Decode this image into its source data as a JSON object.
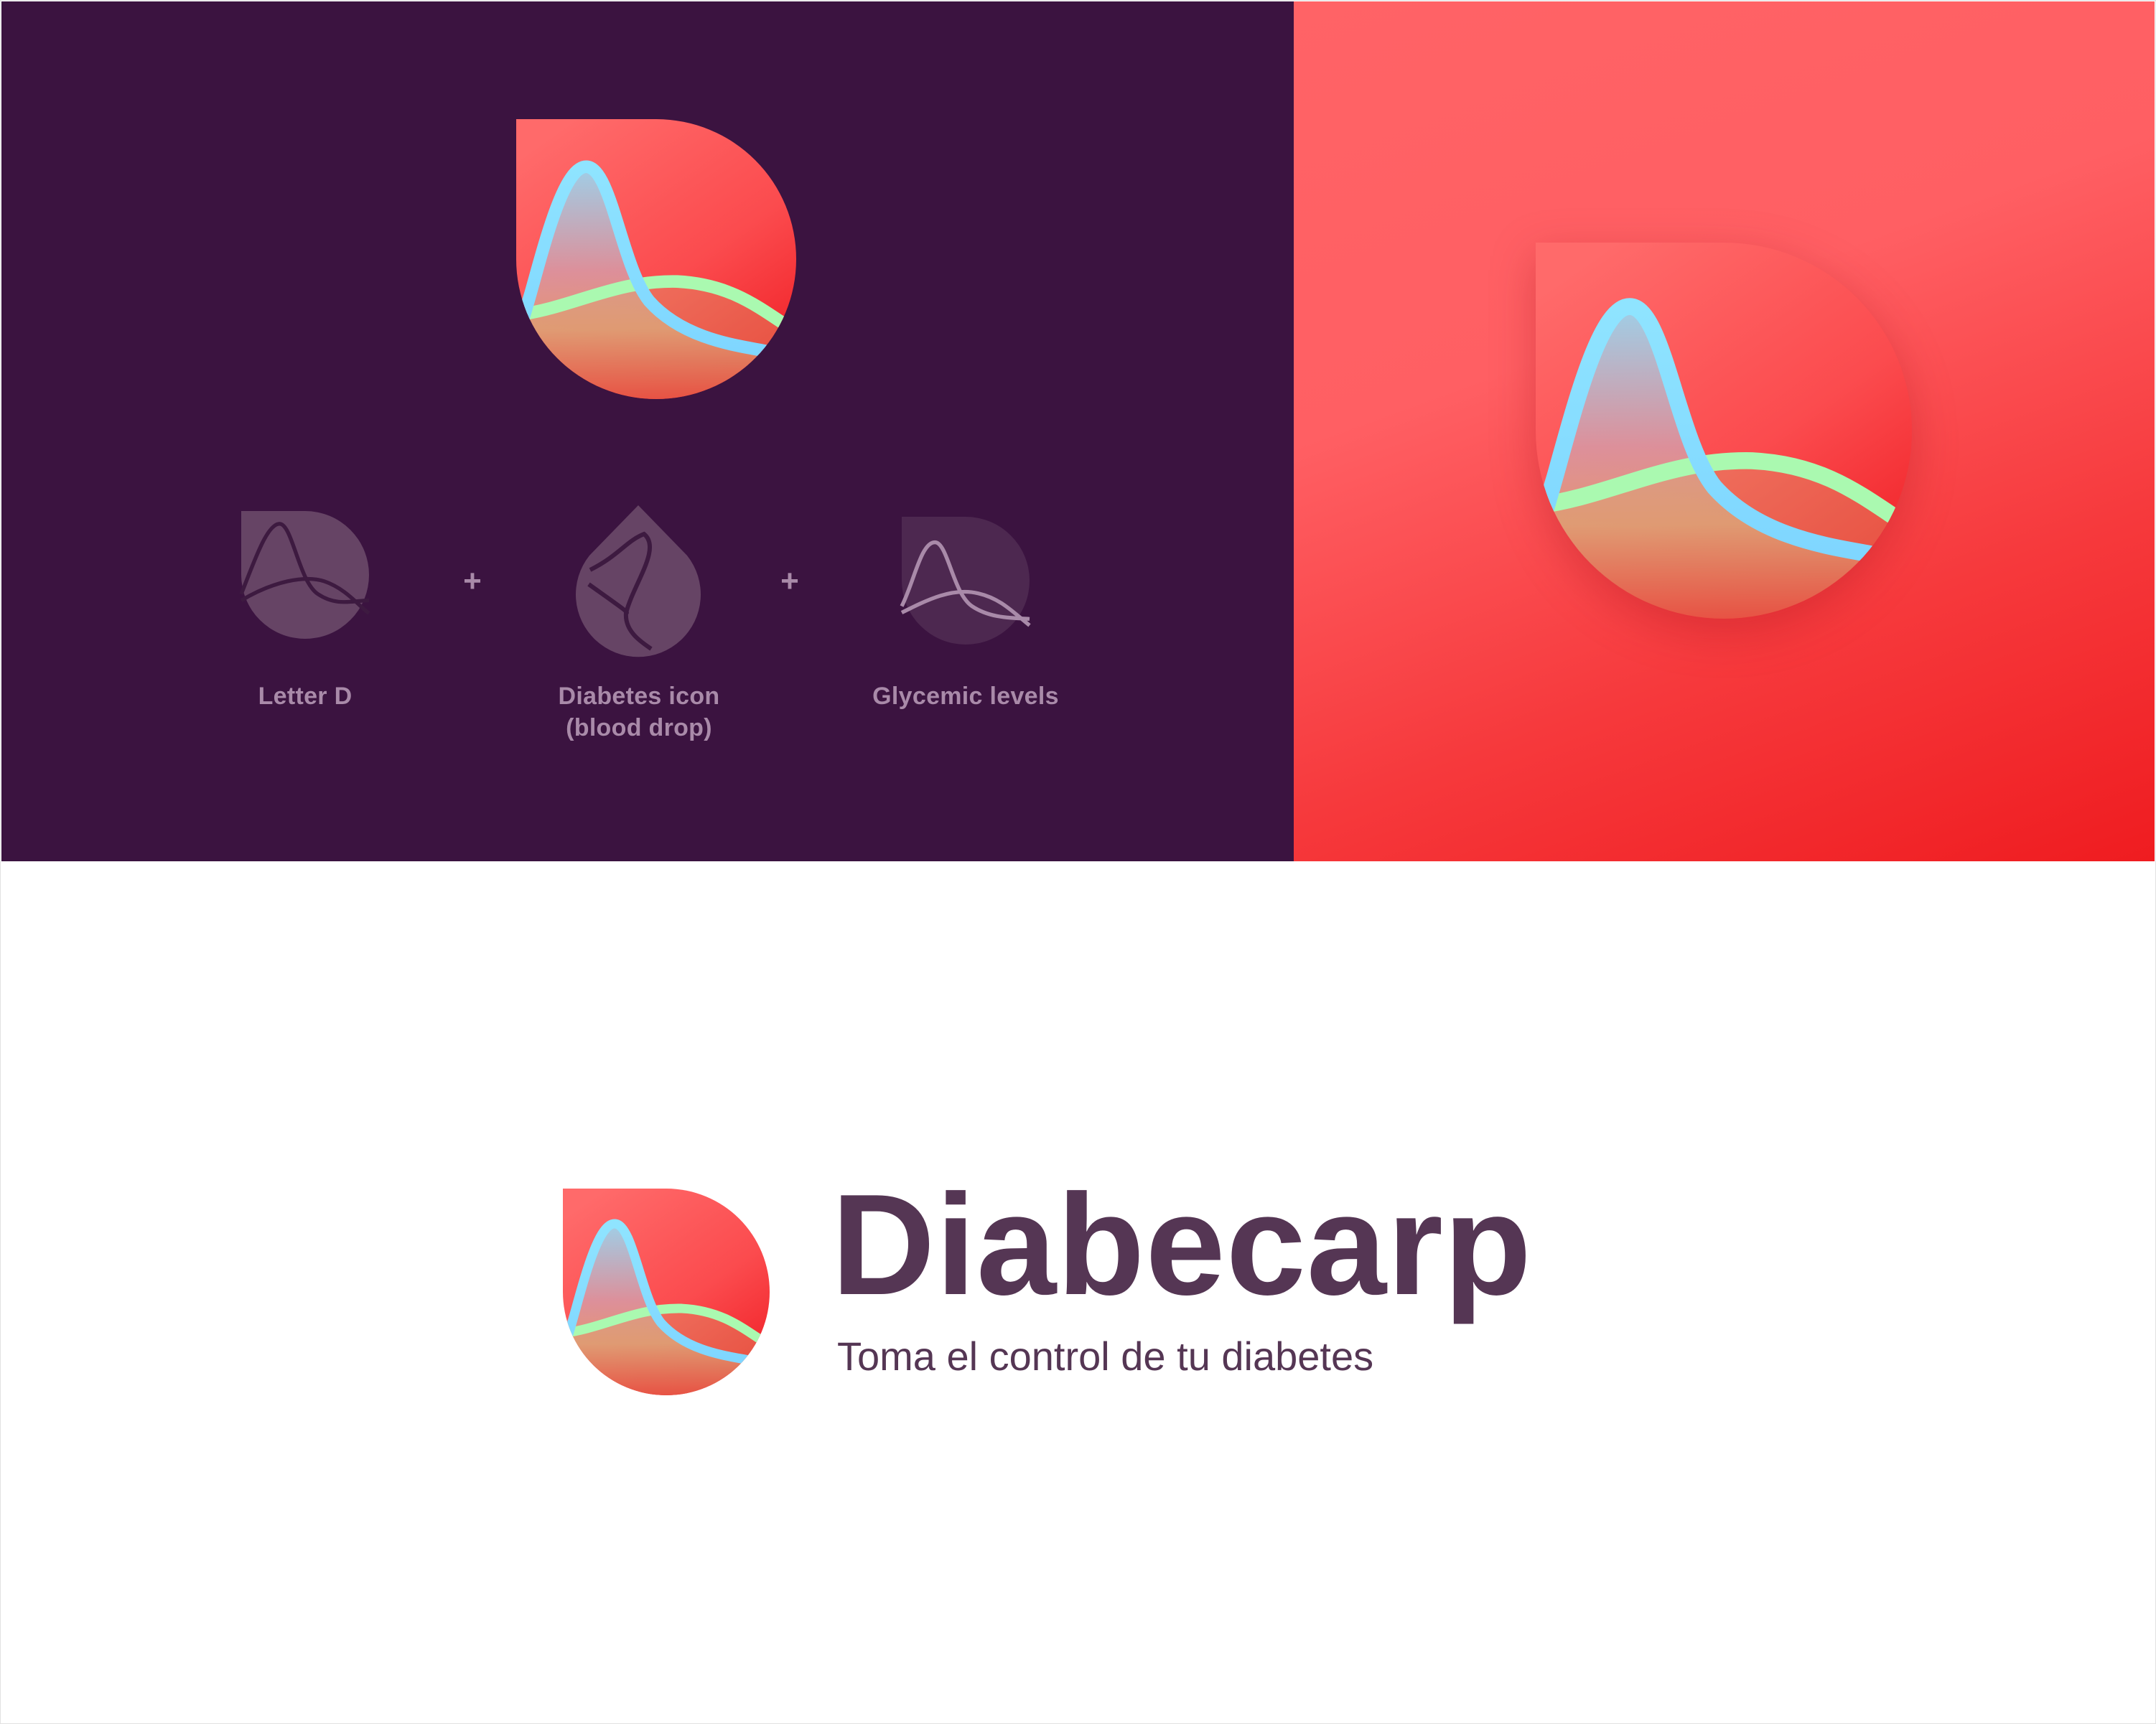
{
  "brand": {
    "name": "Diabecarp",
    "tagline": "Toma el control de tu diabetes"
  },
  "concept": {
    "parts": [
      {
        "label": "Letter D",
        "icon": "letter-d-icon"
      },
      {
        "label": "Diabetes icon\n(blood drop)",
        "icon": "blood-drop-icon"
      },
      {
        "label": "Glycemic levels",
        "icon": "glycemic-levels-icon"
      }
    ],
    "operator": "+"
  },
  "colors": {
    "dark_background": "#3b1340",
    "coral_background": "#ff6366",
    "logo_red": "#f0262a",
    "logo_coral": "#ff6a6a",
    "curve_blue": "#8ee2ff",
    "curve_green": "#aaf9b0",
    "wordmark": "#553654",
    "concept_label": "#a98aa9"
  }
}
